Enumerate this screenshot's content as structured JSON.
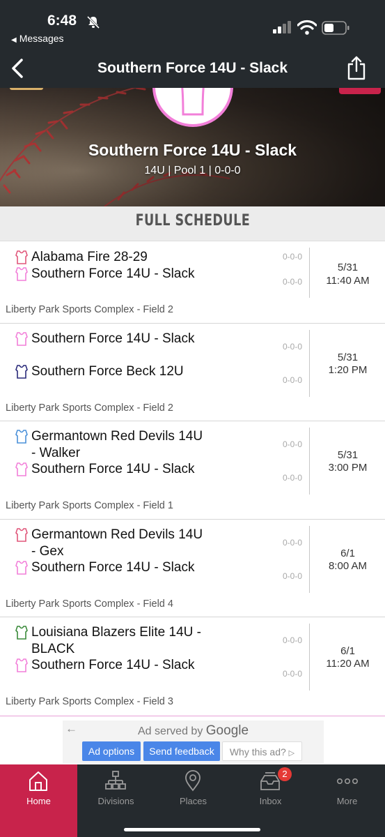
{
  "status_bar": {
    "time": "6:48",
    "back_app": "Messages"
  },
  "nav": {
    "title": "Southern Force 14U - Slack"
  },
  "team": {
    "name": "Southern Force 14U - Slack",
    "meta": "14U | Pool 1 | 0-0-0"
  },
  "section": {
    "title": "FULL SCHEDULE"
  },
  "games": [
    {
      "team1": "Alabama Fire 28-29",
      "team1_color": "#e0567a",
      "team1_score": "0-0-0",
      "team2": "Southern Force 14U - Slack",
      "team2_color": "#f27fd9",
      "team2_score": "0-0-0",
      "date": "5/31",
      "time": "11:40 AM",
      "venue": "Liberty Park Sports Complex - Field 2"
    },
    {
      "team1": "Southern Force 14U - Slack",
      "team1_color": "#f27fd9",
      "team1_score": "0-0-0",
      "team2": "Southern Force Beck 12U",
      "team2_color": "#2a2a7a",
      "team2_score": "0-0-0",
      "date": "5/31",
      "time": "1:20 PM",
      "venue": "Liberty Park Sports Complex - Field 2"
    },
    {
      "team1": "Germantown Red Devils 14U - Walker",
      "team1_color": "#4a90d9",
      "team1_score": "0-0-0",
      "team2": "Southern Force 14U - Slack",
      "team2_color": "#f27fd9",
      "team2_score": "0-0-0",
      "date": "5/31",
      "time": "3:00 PM",
      "venue": "Liberty Park Sports Complex - Field 1"
    },
    {
      "team1": "Germantown Red Devils 14U - Gex",
      "team1_color": "#e0567a",
      "team1_score": "0-0-0",
      "team2": "Southern Force 14U - Slack",
      "team2_color": "#f27fd9",
      "team2_score": "0-0-0",
      "date": "6/1",
      "time": "8:00 AM",
      "venue": "Liberty Park Sports Complex - Field 4"
    },
    {
      "team1": "Louisiana Blazers Elite 14U - BLACK",
      "team1_color": "#3a8a3a",
      "team1_score": "0-0-0",
      "team2": "Southern Force 14U - Slack",
      "team2_color": "#f27fd9",
      "team2_score": "0-0-0",
      "date": "6/1",
      "time": "11:20 AM",
      "venue": "Liberty Park Sports Complex - Field 3"
    }
  ],
  "ad": {
    "served_prefix": "Ad served by",
    "served_brand": "Google",
    "options_label": "Ad options",
    "feedback_label": "Send feedback",
    "why_label": "Why this ad?"
  },
  "tabs": [
    {
      "label": "Home",
      "icon": "home-icon",
      "active": true
    },
    {
      "label": "Divisions",
      "icon": "divisions-icon",
      "active": false
    },
    {
      "label": "Places",
      "icon": "location-pin-icon",
      "active": false
    },
    {
      "label": "Inbox",
      "icon": "inbox-icon",
      "active": false,
      "badge": "2"
    },
    {
      "label": "More",
      "icon": "more-icon",
      "active": false
    }
  ],
  "colors": {
    "brand": "#c8234b",
    "dark_bar": "#252a2e",
    "team_pink": "#f27fd9"
  }
}
